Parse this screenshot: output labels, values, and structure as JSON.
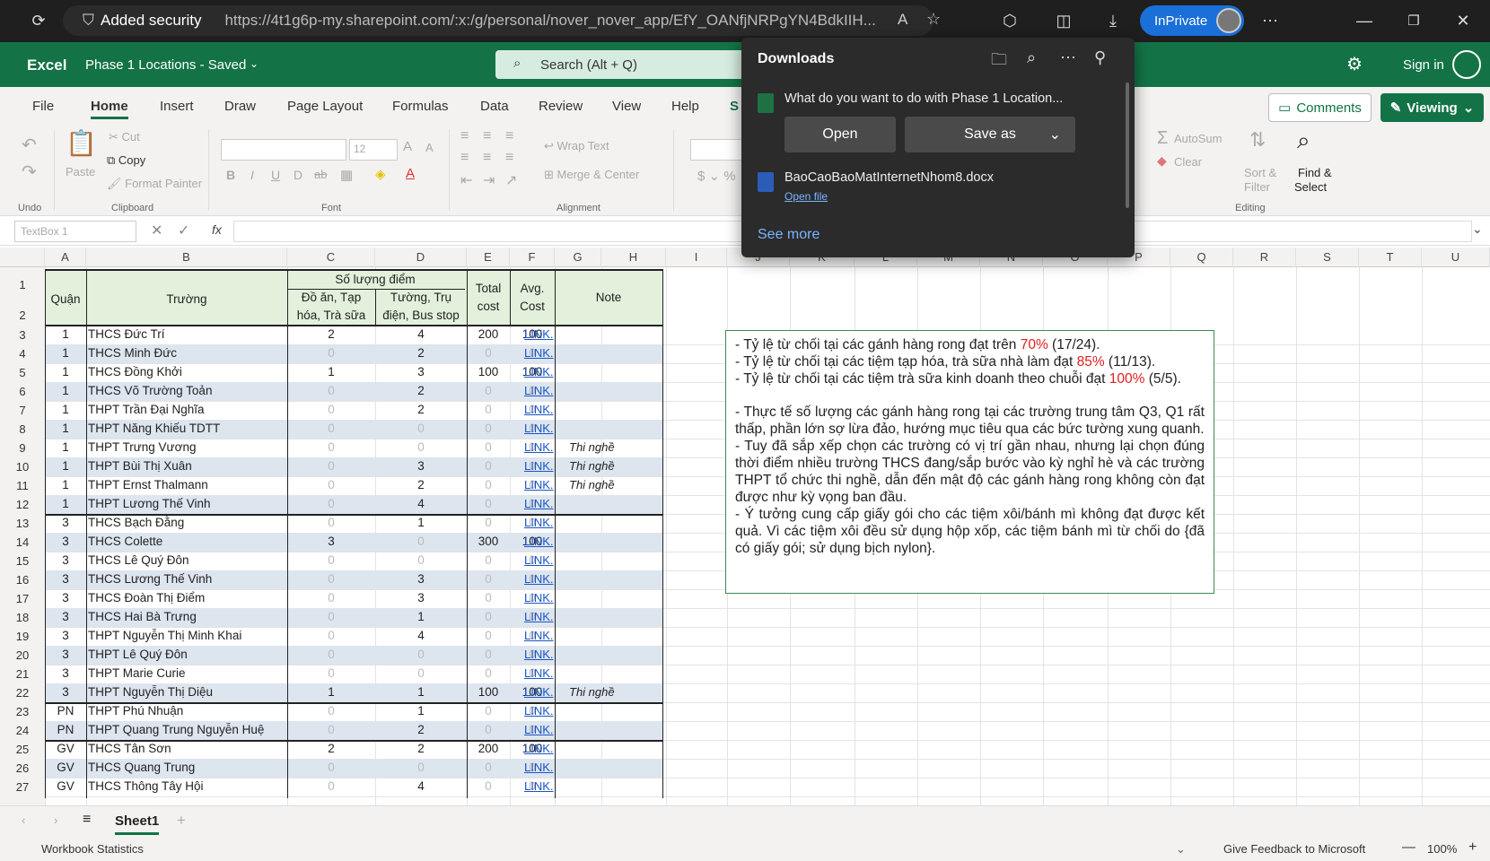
{
  "browser": {
    "security_label": "Added security",
    "url": "https://4t1g6p-my.sharepoint.com/:x:/g/personal/nover_nover_app/EfY_OANfjNRPgYN4BdkIIH...",
    "inprivate_label": "InPrivate"
  },
  "excel": {
    "app_name": "Excel",
    "doc_title": "Phase 1 Locations  -  Saved",
    "search_placeholder": "Search (Alt + Q)",
    "sign_in": "Sign in"
  },
  "ribbon_tabs": [
    "File",
    "Home",
    "Insert",
    "Draw",
    "Page Layout",
    "Formulas",
    "Data",
    "Review",
    "View",
    "Help",
    "S"
  ],
  "ribbon": {
    "comments": "Comments",
    "viewing": "Viewing",
    "undo": "Undo",
    "paste": "Paste",
    "cut": "Cut",
    "copy": "Copy",
    "format_painter": "Format Painter",
    "clipboard": "Clipboard",
    "font_size": "12",
    "font": "Font",
    "wrap_text": "Wrap Text",
    "merge_center": "Merge & Center",
    "alignment": "Alignment",
    "autosum": "AutoSum",
    "clear": "Clear",
    "sort_filter": "Sort &",
    "sort_filter2": "Filter",
    "find_select": "Find &",
    "find_select2": "Select",
    "editing": "Editing"
  },
  "formula_bar": {
    "name_box": "TextBox 1",
    "fx": "fx"
  },
  "columns": [
    "A",
    "B",
    "C",
    "D",
    "E",
    "F",
    "G",
    "H",
    "I",
    "J",
    "K",
    "L",
    "M",
    "N",
    "O",
    "P",
    "Q",
    "R",
    "S",
    "T",
    "U"
  ],
  "header": {
    "quan": "Quận",
    "truong": "Trường",
    "so_luong": "Số lượng điểm",
    "do_an": "Đồ ăn, Tạp",
    "do_an2": "hóa, Trà sữa",
    "tuong": "Tường, Trụ",
    "tuong2": "điện, Bus stop",
    "total": "Total",
    "total2": "cost",
    "avg": "Avg.",
    "avg2": "Cost",
    "note": "Note"
  },
  "rows": [
    {
      "n": "3",
      "q": "1",
      "t": "THCS Đức Trí",
      "c": "2",
      "d": "4",
      "e": "200",
      "f": "100",
      "g": "LINK.",
      "h": ""
    },
    {
      "n": "4",
      "q": "1",
      "t": "THCS Minh Đức",
      "c": "0",
      "d": "2",
      "e": "0",
      "f": "0",
      "g": "LINK.",
      "h": ""
    },
    {
      "n": "5",
      "q": "1",
      "t": "THCS Đồng Khởi",
      "c": "1",
      "d": "3",
      "e": "100",
      "f": "100",
      "g": "LINK.",
      "h": ""
    },
    {
      "n": "6",
      "q": "1",
      "t": "THCS Võ Trường Toản",
      "c": "0",
      "d": "2",
      "e": "0",
      "f": "0",
      "g": "LINK.",
      "h": ""
    },
    {
      "n": "7",
      "q": "1",
      "t": "THPT Trần Đại Nghĩa",
      "c": "0",
      "d": "2",
      "e": "0",
      "f": "0",
      "g": "LINK.",
      "h": ""
    },
    {
      "n": "8",
      "q": "1",
      "t": "THPT Năng Khiếu TDTT",
      "c": "0",
      "d": "0",
      "e": "0",
      "f": "0",
      "g": "LINK.",
      "h": ""
    },
    {
      "n": "9",
      "q": "1",
      "t": "THPT Trưng Vương",
      "c": "0",
      "d": "0",
      "e": "0",
      "f": "0",
      "g": "LINK.",
      "h": "Thi nghề"
    },
    {
      "n": "10",
      "q": "1",
      "t": "THPT Bùi Thị Xuân",
      "c": "0",
      "d": "3",
      "e": "0",
      "f": "0",
      "g": "LINK.",
      "h": "Thi nghề"
    },
    {
      "n": "11",
      "q": "1",
      "t": "THPT Ernst Thalmann",
      "c": "0",
      "d": "2",
      "e": "0",
      "f": "0",
      "g": "LINK.",
      "h": "Thi nghề"
    },
    {
      "n": "12",
      "q": "1",
      "t": "THPT Lương Thế Vinh",
      "c": "0",
      "d": "4",
      "e": "0",
      "f": "0",
      "g": "LINK.",
      "h": ""
    },
    {
      "n": "13",
      "q": "3",
      "t": "THCS Bạch Đằng",
      "c": "0",
      "d": "1",
      "e": "0",
      "f": "0",
      "g": "LINK.",
      "h": ""
    },
    {
      "n": "14",
      "q": "3",
      "t": "THCS Colette",
      "c": "3",
      "d": "0",
      "e": "300",
      "f": "100",
      "g": "LINK.",
      "h": ""
    },
    {
      "n": "15",
      "q": "3",
      "t": "THCS Lê Quý Đôn",
      "c": "0",
      "d": "0",
      "e": "0",
      "f": "0",
      "g": "LINK.",
      "h": ""
    },
    {
      "n": "16",
      "q": "3",
      "t": "THCS Lương Thế Vinh",
      "c": "0",
      "d": "3",
      "e": "0",
      "f": "0",
      "g": "LINK.",
      "h": ""
    },
    {
      "n": "17",
      "q": "3",
      "t": "THCS Đoàn Thị Điểm",
      "c": "0",
      "d": "3",
      "e": "0",
      "f": "0",
      "g": "LINK.",
      "h": ""
    },
    {
      "n": "18",
      "q": "3",
      "t": "THCS Hai Bà Trưng",
      "c": "0",
      "d": "1",
      "e": "0",
      "f": "0",
      "g": "LINK.",
      "h": ""
    },
    {
      "n": "19",
      "q": "3",
      "t": "THPT Nguyễn Thị Minh Khai",
      "c": "0",
      "d": "4",
      "e": "0",
      "f": "0",
      "g": "LINK.",
      "h": ""
    },
    {
      "n": "20",
      "q": "3",
      "t": "THPT Lê Quý Đôn",
      "c": "0",
      "d": "0",
      "e": "0",
      "f": "0",
      "g": "LINK.",
      "h": ""
    },
    {
      "n": "21",
      "q": "3",
      "t": "THPT Marie Curie",
      "c": "0",
      "d": "0",
      "e": "0",
      "f": "0",
      "g": "LINK.",
      "h": ""
    },
    {
      "n": "22",
      "q": "3",
      "t": "THPT Nguyễn Thị Diệu",
      "c": "1",
      "d": "1",
      "e": "100",
      "f": "100",
      "g": "LINK.",
      "h": "Thi nghề"
    },
    {
      "n": "23",
      "q": "PN",
      "t": "THPT Phú Nhuận",
      "c": "0",
      "d": "1",
      "e": "0",
      "f": "0",
      "g": "LINK.",
      "h": ""
    },
    {
      "n": "24",
      "q": "PN",
      "t": "THPT Quang Trung Nguyễn Huệ",
      "c": "0",
      "d": "2",
      "e": "0",
      "f": "0",
      "g": "LINK.",
      "h": ""
    },
    {
      "n": "25",
      "q": "GV",
      "t": "THCS Tân Sơn",
      "c": "2",
      "d": "2",
      "e": "200",
      "f": "100",
      "g": "LINK.",
      "h": ""
    },
    {
      "n": "26",
      "q": "GV",
      "t": "THCS Quang Trung",
      "c": "0",
      "d": "0",
      "e": "0",
      "f": "0",
      "g": "LINK.",
      "h": ""
    },
    {
      "n": "27",
      "q": "GV",
      "t": "THCS Thông Tây Hội",
      "c": "0",
      "d": "4",
      "e": "0",
      "f": "0",
      "g": "LINK.",
      "h": ""
    }
  ],
  "textbox": {
    "l1a": "- Tỷ lệ từ chối tại các gánh hàng rong đạt trên ",
    "l1r": "70%",
    "l1b": " (17/24).",
    "l2a": "- Tỷ lệ từ chối tại các tiệm tạp hóa, trà sữa nhà làm đạt ",
    "l2r": "85%",
    "l2b": " (11/13).",
    "l3a": "- Tỷ lệ từ chối tại các tiệm trà sữa kinh doanh theo chuỗi đạt ",
    "l3r": "100%",
    "l3b": " (5/5).",
    "p2": "- Thực tế số lượng các gánh hàng rong tại các trường trung tâm Q3, Q1 rất thấp, phần lớn sợ lừa đảo, hướng mục tiêu qua các bức tường xung quanh.",
    "p3": "- Tuy đã sắp xếp chọn các trường có vị trí gần nhau, nhưng lại chọn đúng thời điểm nhiều trường THCS đang/sắp bước vào kỳ nghỉ hè và các trường THPT tổ chức thi nghề, dẫn đến mật độ các gánh hàng rong không còn đạt được như kỳ vọng ban đầu.",
    "p4": "- Ý tưởng cung cấp giấy gói cho các tiệm xôi/bánh mì không đạt được kết quả. Vì các tiệm xôi đều sử dụng hộp xốp, các tiệm bánh mì từ chối do {đã có giấy gói; sử dụng bịch nylon}."
  },
  "downloads": {
    "title": "Downloads",
    "question": "What do you want to do with Phase 1 Location...",
    "open": "Open",
    "save_as": "Save as",
    "file": "BaoCaoBaoMatInternetNhom8.docx",
    "open_file": "Open file",
    "see_more": "See more"
  },
  "sheet": {
    "tab": "Sheet1"
  },
  "status": {
    "stats": "Workbook Statistics",
    "feedback": "Give Feedback to Microsoft",
    "zoom": "100%"
  }
}
